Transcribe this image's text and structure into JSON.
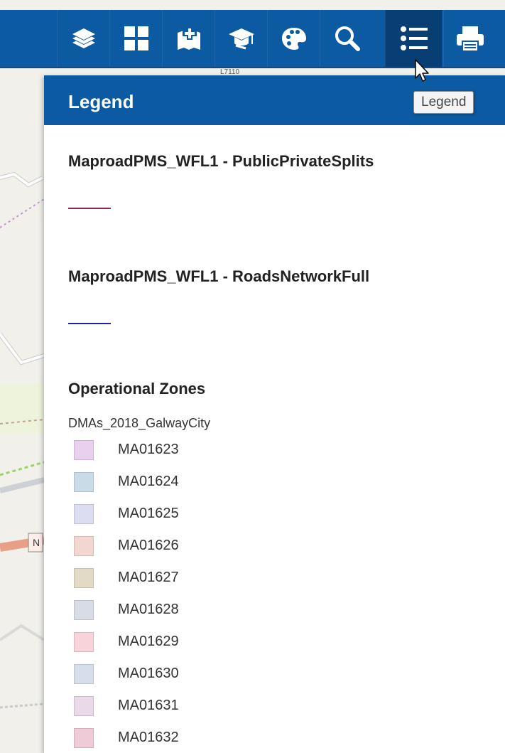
{
  "toolbar": {
    "tools": [
      {
        "icon": "layers-icon",
        "name": "tool-layers"
      },
      {
        "icon": "basemap-gallery-icon",
        "name": "tool-basemap-gallery"
      },
      {
        "icon": "add-data-icon",
        "name": "tool-add-data"
      },
      {
        "icon": "graduation-cap-icon",
        "name": "tool-learn"
      },
      {
        "icon": "palette-icon",
        "name": "tool-palette"
      },
      {
        "icon": "search-icon",
        "name": "tool-search"
      },
      {
        "icon": "legend-list-icon",
        "name": "tool-legend",
        "active": true
      },
      {
        "icon": "print-icon",
        "name": "tool-print"
      }
    ],
    "color": "#0b5aa2",
    "active_color": "#073e73"
  },
  "tooltip": "Legend",
  "legend": {
    "title": "Legend",
    "layers": [
      {
        "title": "MaproadPMS_WFL1 - PublicPrivateSplits",
        "line_color": "#8b2a4e"
      },
      {
        "title": "MaproadPMS_WFL1 - RoadsNetworkFull",
        "line_color": "#1c22a8"
      }
    ],
    "zones": {
      "title": "Operational Zones",
      "subtitle": "DMAs_2018_GalwayCity",
      "items": [
        {
          "label": "MA01623",
          "color": "#ead0ef"
        },
        {
          "label": "MA01624",
          "color": "#cadbe8"
        },
        {
          "label": "MA01625",
          "color": "#dcddf1"
        },
        {
          "label": "MA01626",
          "color": "#f2d6d0"
        },
        {
          "label": "MA01627",
          "color": "#e3dac6"
        },
        {
          "label": "MA01628",
          "color": "#d7dce6"
        },
        {
          "label": "MA01629",
          "color": "#f8d3d9"
        },
        {
          "label": "MA01630",
          "color": "#d5deea"
        },
        {
          "label": "MA01631",
          "color": "#ead9e8"
        },
        {
          "label": "MA01632",
          "color": "#efcad7"
        }
      ]
    }
  },
  "map": {
    "labels": [
      {
        "text": "N"
      }
    ]
  }
}
